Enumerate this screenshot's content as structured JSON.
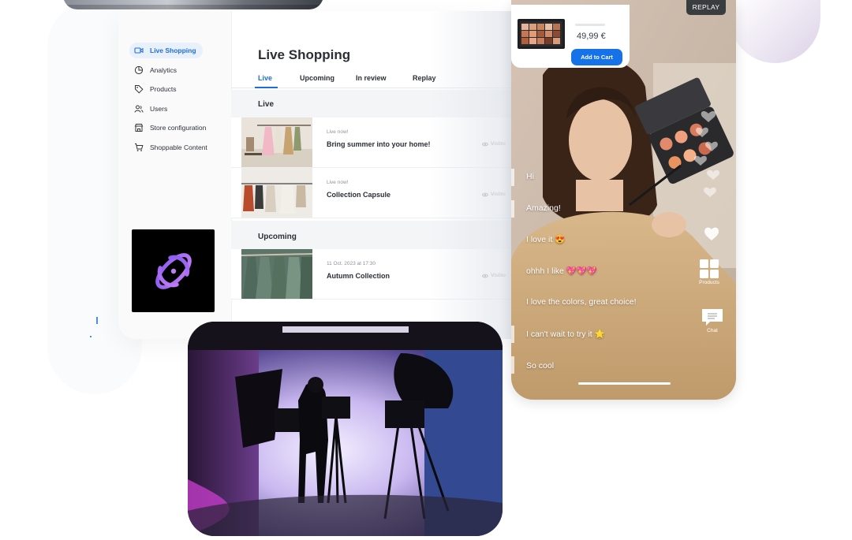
{
  "dashboard": {
    "sidebar": [
      {
        "label": "Live Shopping",
        "icon": "video-camera-icon",
        "active": true
      },
      {
        "label": "Analytics",
        "icon": "pie-chart-icon"
      },
      {
        "label": "Products",
        "icon": "tag-icon"
      },
      {
        "label": "Users",
        "icon": "users-icon"
      },
      {
        "label": "Store configuration",
        "icon": "store-icon"
      },
      {
        "label": "Shoppable Content",
        "icon": "cart-icon"
      }
    ],
    "title": "Live Shopping",
    "tabs": [
      "Live",
      "Upcoming",
      "In review",
      "Replay"
    ],
    "sections": {
      "live": {
        "label": "Live",
        "items": [
          {
            "meta": "Live now!",
            "title": "Bring summer into your home!",
            "visibility": "Visible"
          },
          {
            "meta": "Live now!",
            "title": "Collection Capsule",
            "visibility": "Visible"
          }
        ]
      },
      "upcoming": {
        "label": "Upcoming",
        "items": [
          {
            "meta": "11 Oct. 2023 at 17:30",
            "title": "Autumn Collection",
            "visibility": "Visible"
          }
        ]
      }
    }
  },
  "player": {
    "price": "49,99 €",
    "add_to_cart": "Add to Cart",
    "replay": "REPLAY",
    "chat": [
      "Hi",
      "Amazing!",
      "I love it 😍",
      "ohhh I like 💖💖💖",
      "I love the colors, great choice!",
      "I can't wait to try it 🌟",
      "So cool"
    ],
    "controls": {
      "products": "Products",
      "chat": "Chat"
    }
  },
  "colors": {
    "accent": "#1f6ed8",
    "cart_button": "#1572e8",
    "logo_purple": "#a066f0"
  }
}
